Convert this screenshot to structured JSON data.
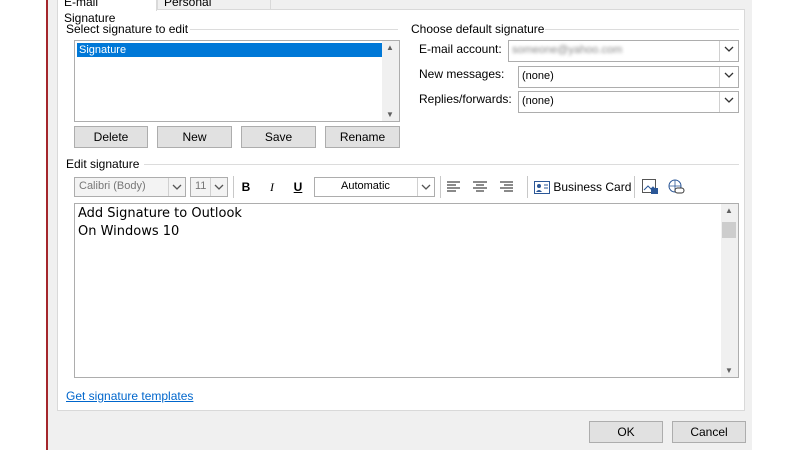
{
  "tabs": [
    {
      "label": "E-mail Signature"
    },
    {
      "label": "Personal Stationery"
    }
  ],
  "select_signature": {
    "group_label": "Select signature to edit",
    "items": [
      "Signature"
    ]
  },
  "buttons": {
    "delete": "Delete",
    "new": "New",
    "save": "Save",
    "rename": "Rename",
    "ok": "OK",
    "cancel": "Cancel"
  },
  "default_signature": {
    "group_label": "Choose default signature",
    "email_account_label": "E-mail account:",
    "email_account_value": "someone@yahoo.com",
    "new_messages_label": "New messages:",
    "new_messages_value": "(none)",
    "replies_label": "Replies/forwards:",
    "replies_value": "(none)"
  },
  "edit_signature": {
    "group_label": "Edit signature",
    "font_value": "Calibri (Body)",
    "size_value": "11",
    "bold": "B",
    "italic": "I",
    "underline": "U",
    "color_value": "Automatic",
    "business_card": "Business Card",
    "lines": [
      "Add Signature to Outlook",
      "On Windows 10"
    ]
  },
  "templates_link": "Get signature templates",
  "colors": {
    "selection": "#0078d7",
    "link": "#0066cc",
    "accent_line": "#a4262c"
  }
}
